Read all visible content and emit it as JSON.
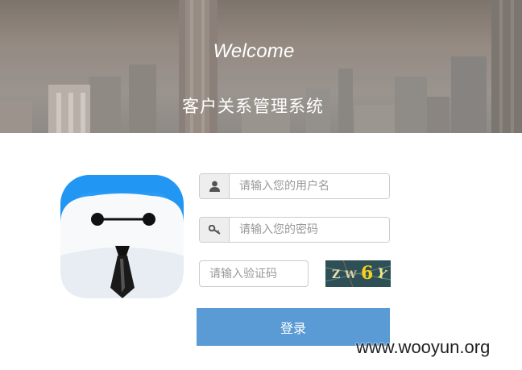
{
  "header": {
    "welcome": "Welcome",
    "system_title": "客户关系管理系统"
  },
  "form": {
    "username_placeholder": "请输入您的用户名",
    "password_placeholder": "请输入您的密码",
    "captcha_placeholder": "请输入验证码",
    "captcha_chars": [
      "Z",
      "W",
      "6",
      "Y"
    ],
    "login_label": "登录"
  },
  "watermark": "www.wooyun.org",
  "colors": {
    "button": "#5a9bd5",
    "logo_blue": "#2196f3"
  },
  "icons": {
    "username": "user-icon",
    "password": "key-icon"
  }
}
